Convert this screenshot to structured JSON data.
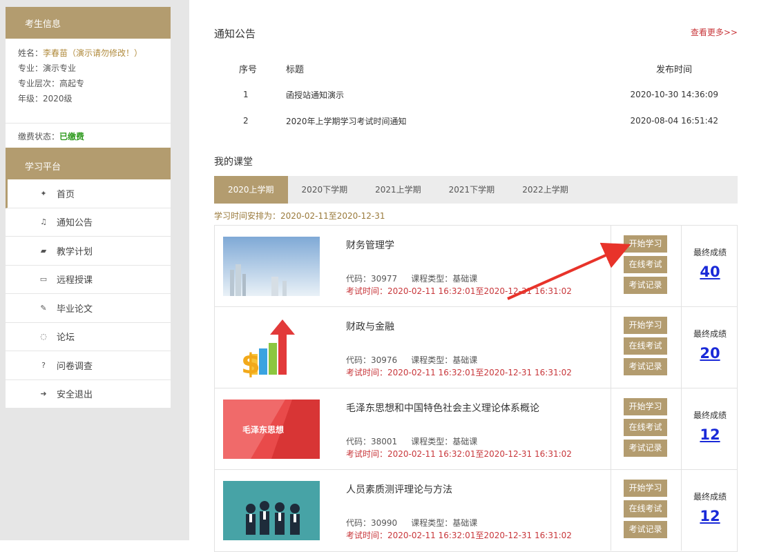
{
  "sidebar": {
    "student_header": "考生信息",
    "name_label": "姓名：",
    "name_value": "李春苗（演示请勿修改！）",
    "major": "专业：演示专业",
    "level": "专业层次：高起专",
    "grade": "年级：2020级",
    "pay_label": "缴费状态：",
    "pay_value": "已缴费",
    "platform_header": "学习平台",
    "nav": [
      {
        "icon": "home-icon",
        "glyph": "✦",
        "label": "首页"
      },
      {
        "icon": "bell-icon",
        "glyph": "♫",
        "label": "通知公告"
      },
      {
        "icon": "book-icon",
        "glyph": "▰",
        "label": "教学计划"
      },
      {
        "icon": "monitor-icon",
        "glyph": "▭",
        "label": "远程授课"
      },
      {
        "icon": "edit-icon",
        "glyph": "✎",
        "label": "毕业论文"
      },
      {
        "icon": "chat-icon",
        "glyph": "◌",
        "label": "论坛"
      },
      {
        "icon": "question-icon",
        "glyph": "?",
        "label": "问卷调查"
      },
      {
        "icon": "logout-icon",
        "glyph": "➜",
        "label": "安全退出"
      }
    ]
  },
  "notice": {
    "title": "通知公告",
    "more": "查看更多>>",
    "headers": [
      "序号",
      "标题",
      "发布时间"
    ],
    "rows": [
      {
        "no": "1",
        "title": "函授站通知演示",
        "time": "2020-10-30 14:36:09"
      },
      {
        "no": "2",
        "title": "2020年上学期学习考试时间通知",
        "time": "2020-08-04 16:51:42"
      }
    ]
  },
  "classroom": {
    "title": "我的课堂",
    "tabs": [
      "2020上学期",
      "2020下学期",
      "2021上学期",
      "2021下学期",
      "2022上学期"
    ],
    "period": "学习时间安排为：2020-02-11至2020-12-31",
    "btn_start": "开始学习",
    "btn_exam": "在线考试",
    "btn_record": "考试记录",
    "score_label": "最终成绩",
    "courses": [
      {
        "name": "财务管理学",
        "code": "代码：30977",
        "type": "课程类型：基础课",
        "time": "考试时间：2020-02-11 16:32:01至2020-12-31 16:31:02",
        "score": "40"
      },
      {
        "name": "财政与金融",
        "code": "代码：30976",
        "type": "课程类型：基础课",
        "time": "考试时间：2020-02-11 16:32:01至2020-12-31 16:31:02",
        "score": "20"
      },
      {
        "name": "毛泽东思想和中国特色社会主义理论体系概论",
        "code": "代码：38001",
        "type": "课程类型：基础课",
        "time": "考试时间：2020-02-11 16:32:01至2020-12-31 16:31:02",
        "score": "12",
        "thumb_text": "毛泽东思想"
      },
      {
        "name": "人员素质测评理论与方法",
        "code": "代码：30990",
        "type": "课程类型：基础课",
        "time": "考试时间：2020-02-11 16:32:01至2020-12-31 16:31:02",
        "score": "12"
      }
    ]
  }
}
